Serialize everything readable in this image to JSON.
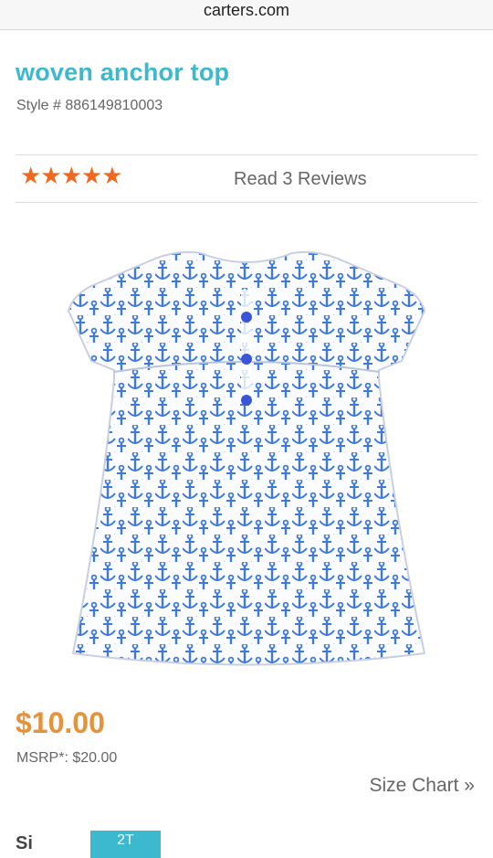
{
  "browser": {
    "url": "carters.com"
  },
  "product": {
    "title": "woven anchor top",
    "style": "Style # 886149810003",
    "rating_stars": "★★★★★",
    "rating_value": 5,
    "reviews_link": "Read 3 Reviews",
    "price": "$10.00",
    "msrp": "MSRP*: $20.00",
    "size_chart_link": "Size Chart »",
    "size_label": "Si",
    "selected_size": "2T"
  },
  "colors": {
    "title": "#3cb8cf",
    "price": "#e5923b",
    "stars": "#ee6a22",
    "anchor": "#3f7ad8"
  }
}
